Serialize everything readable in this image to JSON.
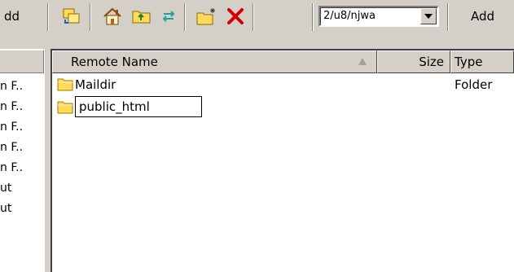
{
  "toolbar": {
    "left_truncated_label": "dd",
    "address_value": "2/u8/njwa",
    "add_label": "Add",
    "icons": [
      "copy-icon",
      "home-icon",
      "parent-folder-icon",
      "refresh-icon",
      "new-folder-icon",
      "delete-icon"
    ]
  },
  "left_pane": {
    "items": [
      "n F..",
      "n F..",
      "n F..",
      "n F..",
      "n F..",
      "ut",
      "ut"
    ]
  },
  "list": {
    "columns": {
      "name": "Remote Name",
      "size": "Size",
      "type": "Type"
    },
    "rows": [
      {
        "name": "Maildir",
        "size": "",
        "type": "Folder",
        "editing": false
      },
      {
        "name": "public_html",
        "size": "",
        "type": "",
        "editing": true
      }
    ]
  },
  "colors": {
    "chrome": "#d4d0c8",
    "folder": "#ffd95a",
    "delete_red": "#d40000"
  }
}
